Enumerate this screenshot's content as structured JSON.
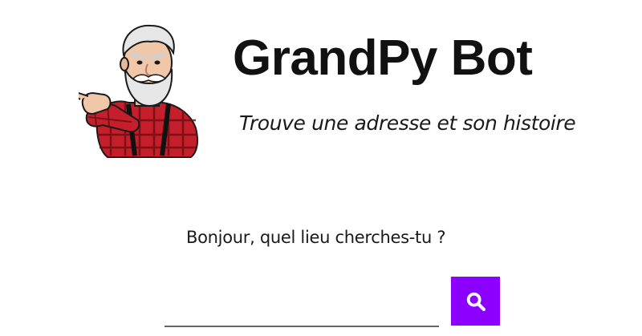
{
  "header": {
    "logo_icon": "lumberjack-grandpa-mascot",
    "title": "GrandPy Bot",
    "tagline": "Trouve une adresse et son histoire"
  },
  "main": {
    "greeting": "Bonjour, quel lieu cherches-tu ?",
    "search": {
      "value": "",
      "placeholder": "",
      "button_icon": "search-icon"
    }
  },
  "colors": {
    "accent": "#8c00ff",
    "text": "#111111",
    "shirt_red": "#c41f2b",
    "beard": "#e6e6e6"
  }
}
